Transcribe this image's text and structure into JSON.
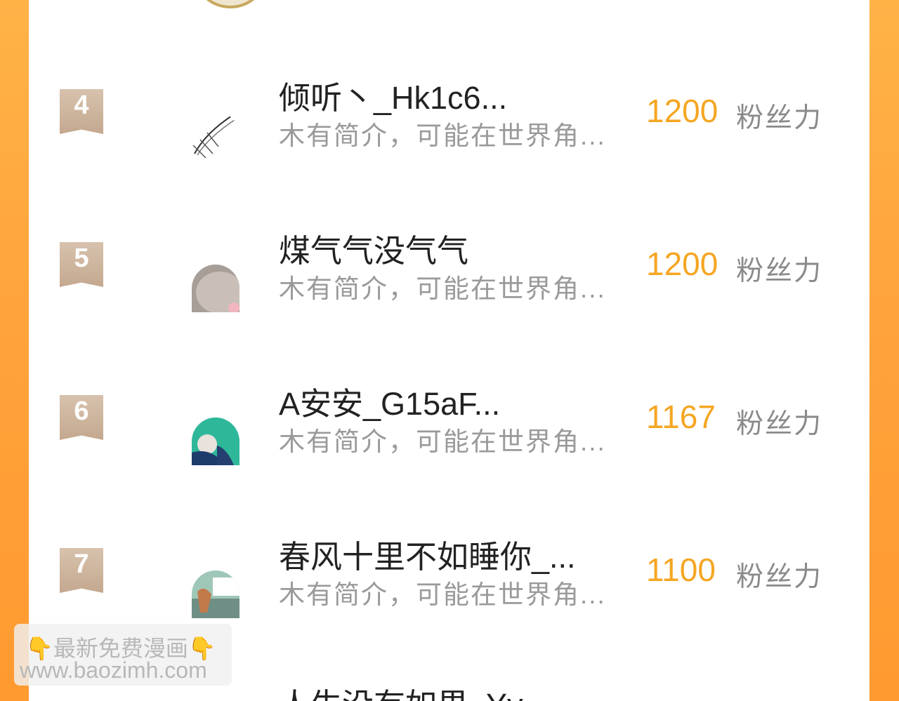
{
  "rankings": [
    {
      "rank": "4",
      "name": "倾听丶_Hk1c6...",
      "bio": "木有简介，可能在世界角...",
      "score": "1200",
      "unit": "粉丝力"
    },
    {
      "rank": "5",
      "name": "煤气气没气气",
      "bio": "木有简介，可能在世界角...",
      "score": "1200",
      "unit": "粉丝力"
    },
    {
      "rank": "6",
      "name": "A安安_G15aF...",
      "bio": "木有简介，可能在世界角...",
      "score": "1167",
      "unit": "粉丝力"
    },
    {
      "rank": "7",
      "name": "春风十里不如睡你_...",
      "bio": "木有简介，可能在世界角...",
      "score": "1100",
      "unit": "粉丝力"
    }
  ],
  "next_partial_name": "人生没有如果_Yy",
  "watermark": {
    "emoji": "👇",
    "line1": "最新免费漫画",
    "line2": "www.baozimh.com"
  },
  "colors": {
    "score": "#f5a623",
    "badge": "#c9ad95",
    "background": "#ffa23a"
  }
}
